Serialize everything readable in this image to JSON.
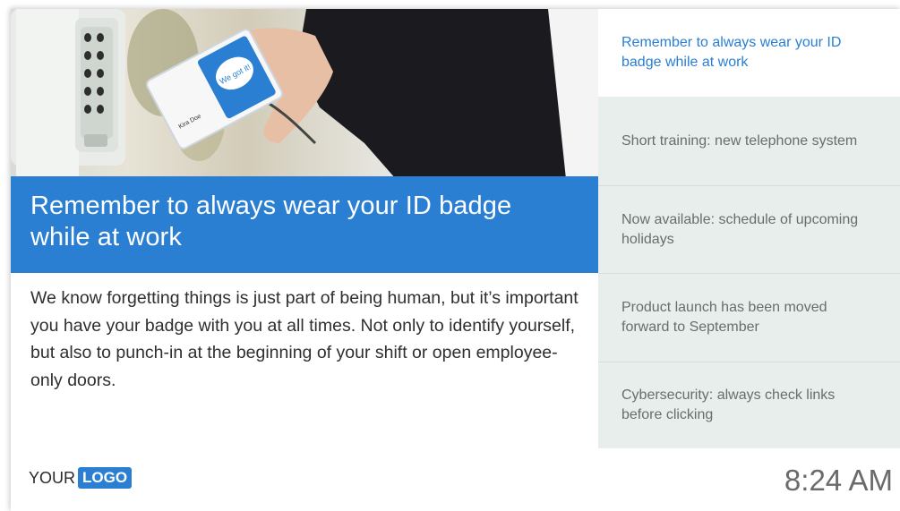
{
  "hero": {
    "badge_bubble_text": "We got it!",
    "badge_name_text": "Kira Doe"
  },
  "main": {
    "title": "Remember to always wear your ID badge while at work",
    "body": "We know forgetting things is just part of being human, but it’s important you have your badge with you at all times. Not only to identify yourself, but also to punch-in at the beginning of your shift or open employee-only doors."
  },
  "sidebar": {
    "items": [
      {
        "label": "Remember to always wear your ID badge while at work",
        "active": true
      },
      {
        "label": "Short training: new telephone system",
        "active": false
      },
      {
        "label": "Now available: schedule of upcoming holidays",
        "active": false
      },
      {
        "label": "Product launch has been moved forward to September",
        "active": false
      },
      {
        "label": "Cybersecurity: always check links before clicking",
        "active": false
      }
    ]
  },
  "footer": {
    "logo_prefix": "YOUR",
    "logo_highlight": "LOGO",
    "time": "8:24 AM"
  },
  "colors": {
    "accent": "#2a7fd3",
    "sidebar_bg": "#e8eeec"
  }
}
